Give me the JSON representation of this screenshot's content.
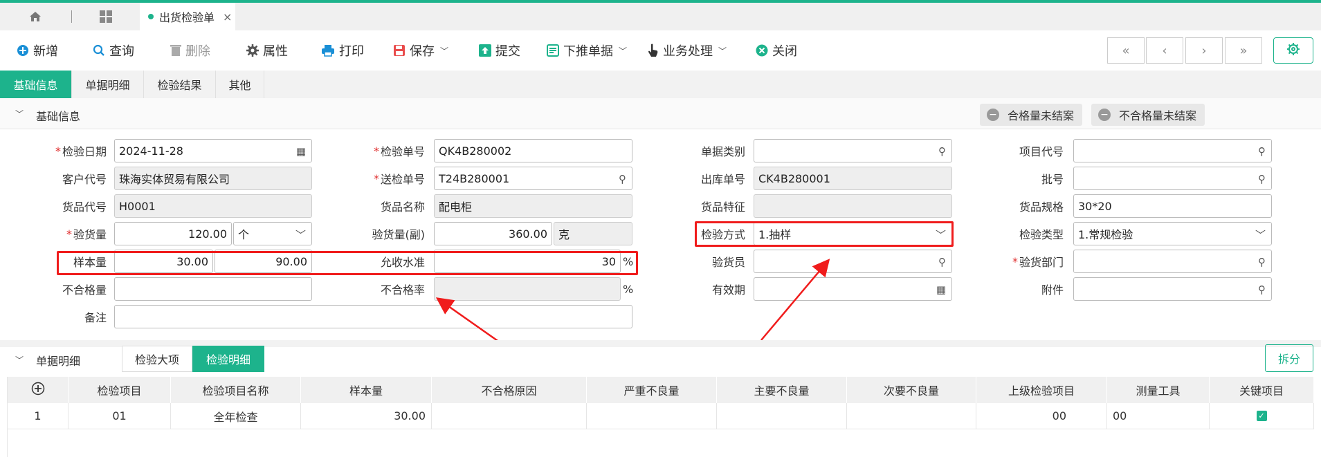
{
  "tabbar": {
    "home_icon": "home-icon",
    "apps_icon": "apps-icon",
    "doc_tab_label": "出货检验单",
    "close_glyph": "×"
  },
  "toolbar": {
    "new": "新增",
    "query": "查询",
    "delete": "删除",
    "properties": "属性",
    "print": "打印",
    "save": "保存",
    "submit": "提交",
    "push_down": "下推单据",
    "business": "业务处理",
    "close": "关闭"
  },
  "nav": {
    "first": "«",
    "prev": "‹",
    "next": "›",
    "last": "»"
  },
  "subtabs": [
    "基础信息",
    "单据明细",
    "检验结果",
    "其他"
  ],
  "basic_section": {
    "title": "基础信息",
    "qualified_pill": "合格量未结案",
    "unqualified_pill": "不合格量未结案"
  },
  "form": {
    "inspect_date_label": "检验日期",
    "inspect_date": "2024-11-28",
    "inspect_no_label": "检验单号",
    "inspect_no": "QK4B280002",
    "doc_type_label": "单据类别",
    "doc_type": "",
    "project_code_label": "项目代号",
    "project_code": "",
    "customer_label": "客户代号",
    "customer": "珠海实体贸易有限公司",
    "send_no_label": "送检单号",
    "send_no": "T24B280001",
    "outbound_no_label": "出库单号",
    "outbound_no": "CK4B280001",
    "batch_label": "批号",
    "batch": "",
    "item_code_label": "货品代号",
    "item_code": "H0001",
    "item_name_label": "货品名称",
    "item_name": "配电柜",
    "item_feature_label": "货品特征",
    "item_feature": "",
    "item_spec_label": "货品规格",
    "item_spec": "30*20",
    "qty_label": "验货量",
    "qty": "120.00",
    "qty_unit": "个",
    "qty_sub_label": "验货量(副)",
    "qty_sub": "360.00",
    "qty_sub_unit": "克",
    "method_label": "检验方式",
    "method": "1.抽样",
    "type_label": "检验类型",
    "type": "1.常规检验",
    "sample_label": "样本量",
    "sample_1": "30.00",
    "sample_2": "90.00",
    "aql_label": "允收水准",
    "aql": "30",
    "percent": "%",
    "inspector_label": "验货员",
    "inspector": "",
    "dept_label": "验货部门",
    "dept": "",
    "defect_qty_label": "不合格量",
    "defect_qty": "",
    "defect_rate_label": "不合格率",
    "defect_rate": "",
    "expiry_label": "有效期",
    "expiry": "",
    "attach_label": "附件",
    "attach": "",
    "remark_label": "备注",
    "remark": ""
  },
  "detail_section": {
    "title": "单据明细",
    "tab_major": "检验大项",
    "tab_detail": "检验明细",
    "split": "拆分"
  },
  "grid": {
    "columns": [
      "检验项目",
      "检验项目名称",
      "样本量",
      "不合格原因",
      "严重不良量",
      "主要不良量",
      "次要不良量",
      "上级检验项目",
      "测量工具",
      "关键项目"
    ],
    "rows": [
      {
        "no": "1",
        "item": "01",
        "name": "全年检查",
        "sample": "30.00",
        "reason": "",
        "critical": "",
        "major": "",
        "minor": "",
        "parent": "00",
        "tool": "00",
        "key": true
      }
    ]
  },
  "colors": {
    "accent": "#1db38c",
    "highlight": "#f01c1c",
    "required": "#e03030"
  }
}
